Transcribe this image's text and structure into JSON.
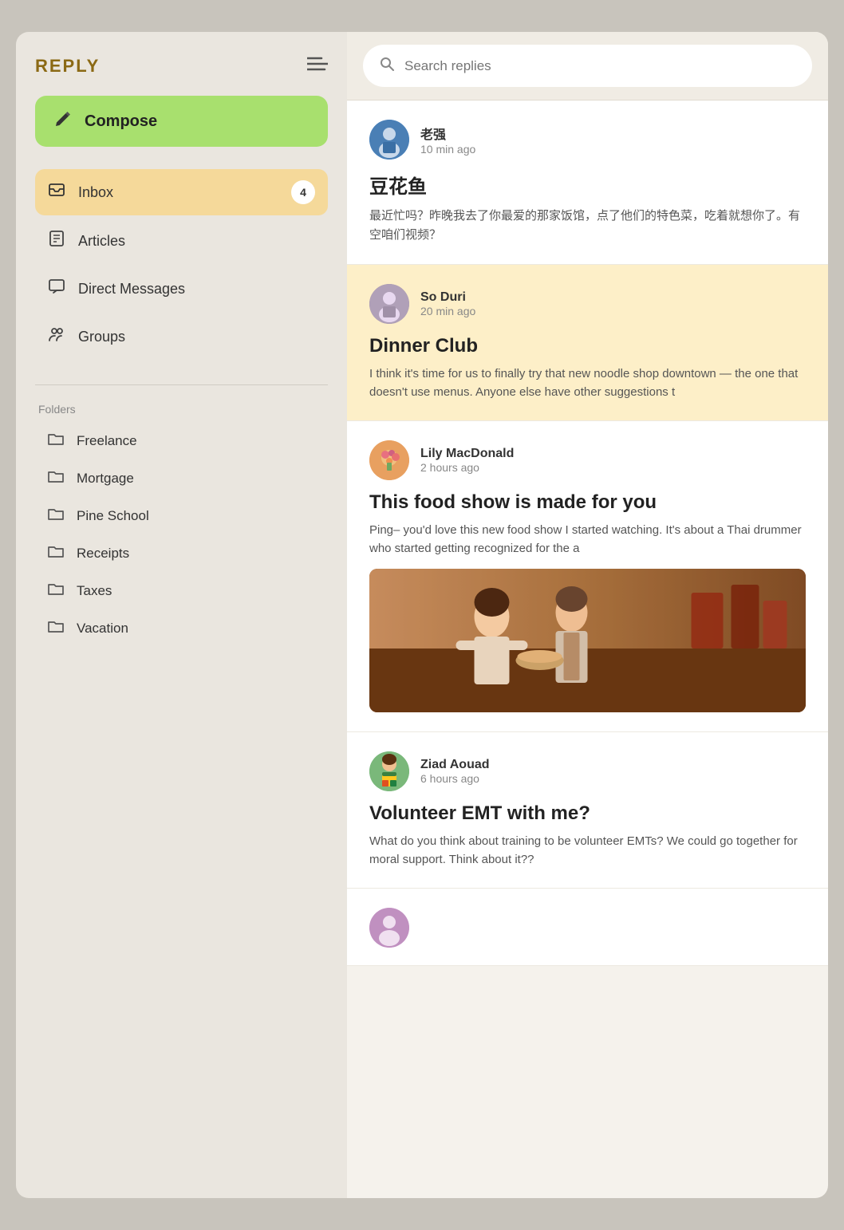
{
  "app": {
    "logo": "REPLY",
    "menu_icon": "≡"
  },
  "sidebar": {
    "compose_label": "Compose",
    "nav_items": [
      {
        "id": "inbox",
        "label": "Inbox",
        "icon": "inbox",
        "badge": 4,
        "active": true
      },
      {
        "id": "articles",
        "label": "Articles",
        "icon": "articles",
        "badge": null,
        "active": false
      },
      {
        "id": "direct-messages",
        "label": "Direct Messages",
        "icon": "chat",
        "badge": null,
        "active": false
      },
      {
        "id": "groups",
        "label": "Groups",
        "icon": "groups",
        "badge": null,
        "active": false
      }
    ],
    "folders_label": "Folders",
    "folders": [
      {
        "id": "freelance",
        "label": "Freelance"
      },
      {
        "id": "mortgage",
        "label": "Mortgage"
      },
      {
        "id": "pine-school",
        "label": "Pine School"
      },
      {
        "id": "receipts",
        "label": "Receipts"
      },
      {
        "id": "taxes",
        "label": "Taxes"
      },
      {
        "id": "vacation",
        "label": "Vacation"
      }
    ]
  },
  "search": {
    "placeholder": "Search replies"
  },
  "messages": [
    {
      "id": "msg1",
      "sender": "老强",
      "time": "10 min ago",
      "subject": "豆花鱼",
      "preview": "最近忙吗？昨晚我去了你最爱的那家饭馆，点了他们的特色菜，吃着就想你了。有空咱们视频？",
      "highlighted": false,
      "has_image": false,
      "avatar_color": "laozhuang"
    },
    {
      "id": "msg2",
      "sender": "So Duri",
      "time": "20 min ago",
      "subject": "Dinner Club",
      "preview": "I think it's time for us to finally try that new noodle shop downtown — the one that doesn't use menus. Anyone else have other suggestions t",
      "highlighted": true,
      "has_image": false,
      "avatar_color": "soduri"
    },
    {
      "id": "msg3",
      "sender": "Lily MacDonald",
      "time": "2 hours ago",
      "subject": "This food show is made for you",
      "preview": "Ping– you'd love this new food show I started watching. It's about a Thai drummer who started getting recognized for the a",
      "highlighted": false,
      "has_image": true,
      "avatar_color": "lily"
    },
    {
      "id": "msg4",
      "sender": "Ziad Aouad",
      "time": "6 hours ago",
      "subject": "Volunteer EMT with me?",
      "preview": "What do you think about training to be volunteer EMTs? We could go together for moral support. Think about it??",
      "highlighted": false,
      "has_image": false,
      "avatar_color": "ziad"
    }
  ]
}
